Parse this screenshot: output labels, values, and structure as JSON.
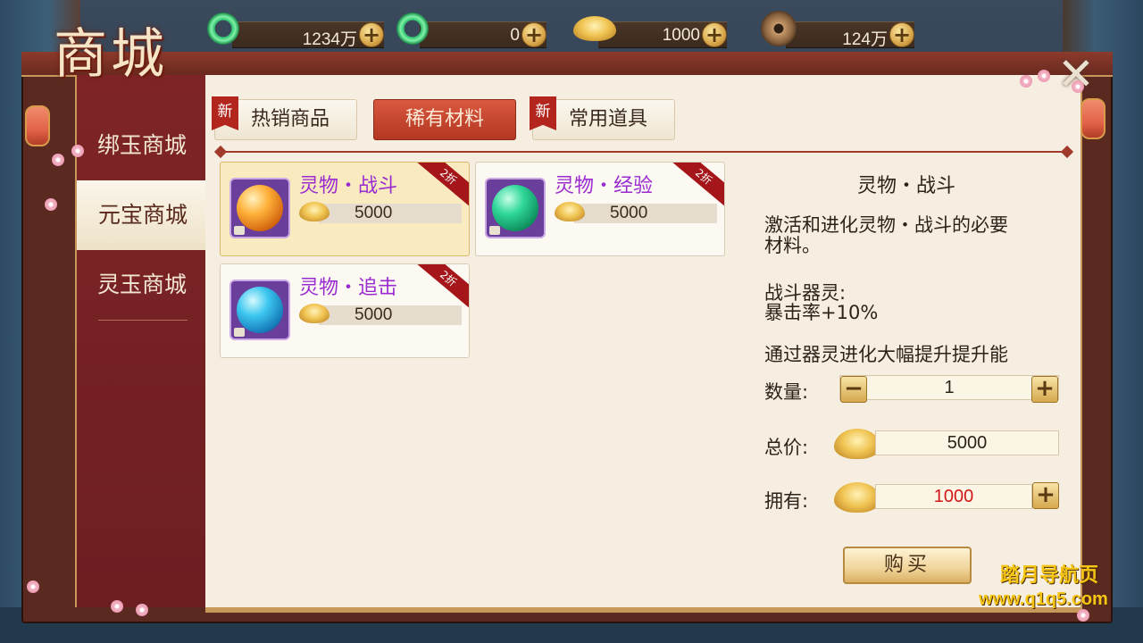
{
  "window_title": "商城",
  "currencies": [
    {
      "icon": "jade-ring-icon",
      "value": "1234万"
    },
    {
      "icon": "locked-jade-ring-icon",
      "value": "0"
    },
    {
      "icon": "gold-ingot-icon",
      "value": "1000"
    },
    {
      "icon": "copper-coin-icon",
      "value": "124万"
    }
  ],
  "sidebar": {
    "items": [
      {
        "label": "绑玉商城",
        "active": false
      },
      {
        "label": "元宝商城",
        "active": true
      },
      {
        "label": "灵玉商城",
        "active": false
      }
    ]
  },
  "tabs": [
    {
      "label": "热销商品",
      "badge": "新",
      "active": false
    },
    {
      "label": "稀有材料",
      "badge": "",
      "active": true
    },
    {
      "label": "常用道具",
      "badge": "新",
      "active": false
    }
  ],
  "items": [
    {
      "name": "灵物・战斗",
      "price": "5000",
      "discount": "2折",
      "orb": "orange",
      "selected": true
    },
    {
      "name": "灵物・经验",
      "price": "5000",
      "discount": "2折",
      "orb": "green",
      "selected": false
    },
    {
      "name": "灵物・追击",
      "price": "5000",
      "discount": "2折",
      "orb": "blue",
      "selected": false
    }
  ],
  "detail": {
    "title": "灵物・战斗",
    "desc_line1": "激活和进化灵物・战斗的必要",
    "desc_line2": "材料。",
    "stat_title": "战斗器灵:",
    "stat_value": "暴击率+10%",
    "upgrade_note": "通过器灵进化大幅提升提升能",
    "qty_label": "数量:",
    "qty_value": "1",
    "total_label": "总价:",
    "total_value": "5000",
    "own_label": "拥有:",
    "own_value": "1000",
    "buy_label": "购买"
  },
  "watermark": {
    "line1": "踏月导航页",
    "line2": "www.q1q5.com"
  },
  "colors": {
    "item_name": "#9a2bd0",
    "own_value": "#d01818",
    "active_tab": "#b33722",
    "sidebar_bg": "#7e2426"
  }
}
